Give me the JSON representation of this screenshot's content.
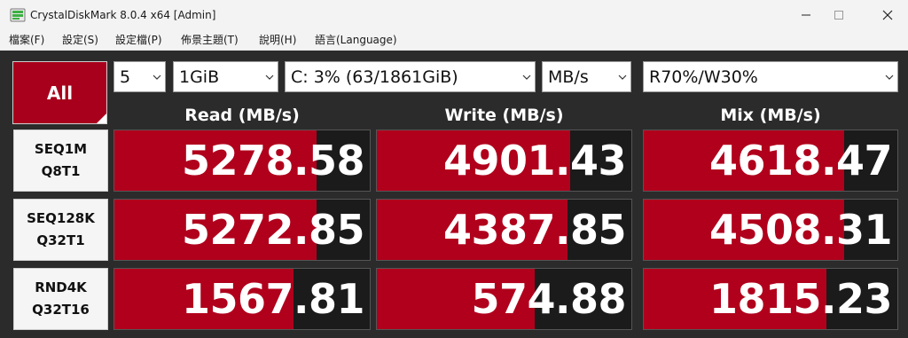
{
  "window": {
    "title": "CrystalDiskMark 8.0.4 x64 [Admin]"
  },
  "menu": [
    "檔案(F)",
    "設定(S)",
    "設定檔(P)",
    "佈景主題(T)",
    "說明(H)",
    "語言(Language)"
  ],
  "all_button": {
    "label": "All"
  },
  "controls": {
    "count": "5",
    "size": "1GiB",
    "drive": "C: 3% (63/1861GiB)",
    "unit": "MB/s",
    "mix": "R70%/W30%"
  },
  "columns": {
    "read": "Read (MB/s)",
    "write": "Write (MB/s)",
    "mix": "Mix (MB/s)"
  },
  "colors": {
    "bar": "#b0001c",
    "all_button": "#a8001c",
    "cell_bg": "#1b1b1b",
    "background": "#2b2b2b"
  },
  "rows": [
    {
      "line1": "SEQ1M",
      "line2": "Q8T1",
      "read": "5278.58",
      "write": "4901.43",
      "mix": "4618.47",
      "read_fill": 0.79,
      "write_fill": 0.76,
      "mix_fill": 0.79
    },
    {
      "line1": "SEQ128K",
      "line2": "Q32T1",
      "read": "5272.85",
      "write": "4387.85",
      "mix": "4508.31",
      "read_fill": 0.79,
      "write_fill": 0.75,
      "mix_fill": 0.79
    },
    {
      "line1": "RND4K",
      "line2": "Q32T16",
      "read": "1567.81",
      "write": "574.88",
      "mix": "1815.23",
      "read_fill": 0.7,
      "write_fill": 0.62,
      "mix_fill": 0.72
    }
  ]
}
